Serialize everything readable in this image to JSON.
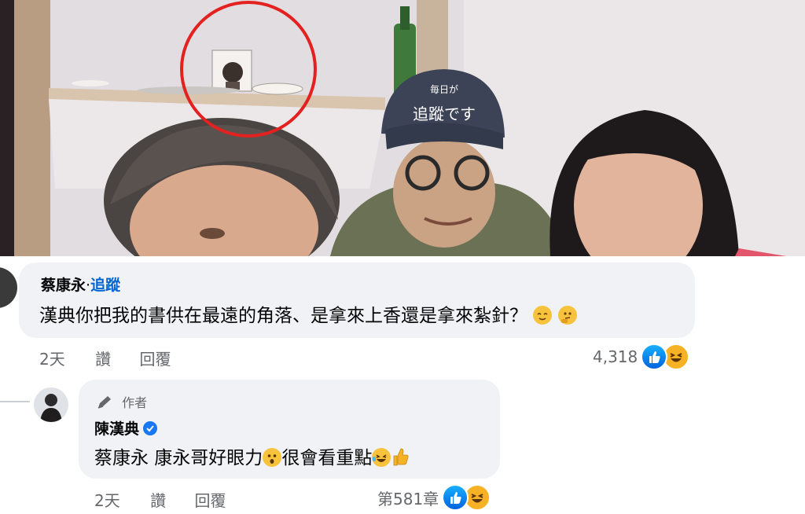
{
  "comments": [
    {
      "author": "蔡康永",
      "follow_label": "追蹤",
      "text": "漢典你把我的書供在最遠的角落、是拿來上香還是拿來紮針？",
      "emoji_trail": [
        "relieved-face-icon",
        "thinking-face-icon"
      ],
      "time": "2天",
      "like_label": "讚",
      "reply_label": "回覆",
      "reaction_count": "4,318",
      "reactions": [
        "like-icon",
        "haha-icon"
      ]
    },
    {
      "author_tag": "作者",
      "author": "陳漢典",
      "verified": true,
      "mention": "蔡康永",
      "text_part1": " 康永哥好眼力",
      "text_part2": "很會看重點",
      "time": "2天",
      "like_label": "讚",
      "reply_label": "回覆",
      "reaction_count": "第581章",
      "reactions": [
        "like-icon",
        "haha-icon"
      ]
    }
  ],
  "photo": {
    "cap_text_small": "毎日が",
    "cap_text_big": "追蹤です"
  },
  "colors": {
    "bubble": "#f0f2f5",
    "link_blue": "#0064d1",
    "meta_gray": "#65676b",
    "highlight_circle": "#e3211f"
  }
}
